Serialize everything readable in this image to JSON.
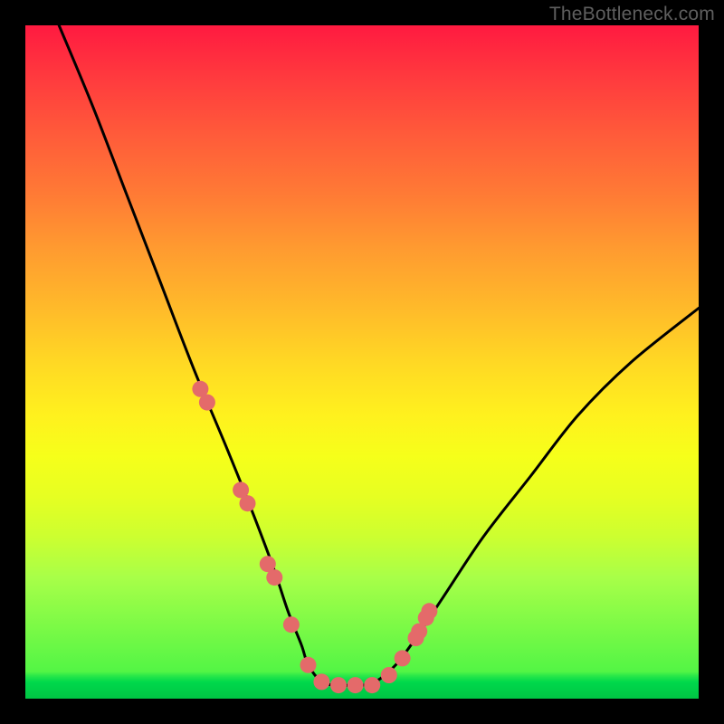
{
  "watermark": "TheBottleneck.com",
  "colors": {
    "curve": "#000000",
    "marker_fill": "#e46a6a",
    "marker_stroke": "#c94f4f",
    "bg_top": "#ff1a40",
    "bg_bottom": "#00c544"
  },
  "chart_data": {
    "type": "line",
    "title": "",
    "xlabel": "",
    "ylabel": "",
    "xlim": [
      0,
      100
    ],
    "ylim": [
      0,
      100
    ],
    "grid": false,
    "legend": false,
    "series": [
      {
        "name": "bottleneck-curve",
        "x": [
          5,
          10,
          15,
          20,
          25,
          30,
          34,
          37,
          39,
          41,
          42,
          44,
          46,
          48,
          50,
          52,
          55,
          58,
          62,
          68,
          75,
          82,
          90,
          100
        ],
        "values": [
          100,
          88,
          75,
          62,
          49,
          37,
          27,
          19,
          13,
          8,
          5,
          2.5,
          2,
          2,
          2,
          2.5,
          5,
          9,
          15,
          24,
          33,
          42,
          50,
          58
        ]
      }
    ],
    "markers": {
      "name": "highlight-points",
      "x": [
        26,
        27,
        32,
        33,
        36,
        37,
        39.5,
        42,
        44,
        46.5,
        49,
        51.5,
        54,
        56,
        58,
        58.5,
        59.5,
        60
      ],
      "values": [
        46,
        44,
        31,
        29,
        20,
        18,
        11,
        5,
        2.5,
        2,
        2,
        2,
        3.5,
        6,
        9,
        10,
        12,
        13
      ]
    }
  }
}
